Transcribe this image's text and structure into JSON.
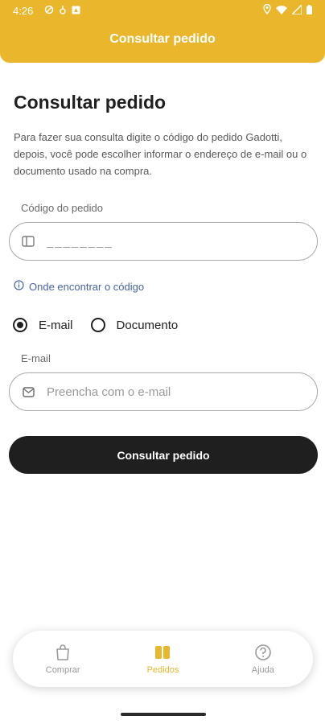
{
  "status_bar": {
    "time": "4:26"
  },
  "header": {
    "title": "Consultar pedido"
  },
  "main": {
    "title": "Consultar pedido",
    "intro": "Para fazer sua consulta digite o código do pedido Gadotti, depois, você pode escolher informar o endereço de e-mail ou o documento usado na compra.",
    "order_code": {
      "label": "Código do pedido",
      "placeholder": "________",
      "value": ""
    },
    "help_link": "Onde encontrar o código",
    "radio_options": [
      {
        "label": "E-mail",
        "selected": true
      },
      {
        "label": "Documento",
        "selected": false
      }
    ],
    "email": {
      "label": "E-mail",
      "placeholder": "Preencha com o e-mail",
      "value": ""
    },
    "submit_label": "Consultar pedido"
  },
  "bottom_nav": {
    "items": [
      {
        "label": "Comprar",
        "icon": "shopping-bag-icon",
        "active": false
      },
      {
        "label": "Pedidos",
        "icon": "orders-icon",
        "active": true
      },
      {
        "label": "Ajuda",
        "icon": "help-circle-icon",
        "active": false
      }
    ]
  },
  "colors": {
    "accent": "#e9b62c",
    "button": "#1f1f1f",
    "link": "#4a63a8"
  }
}
